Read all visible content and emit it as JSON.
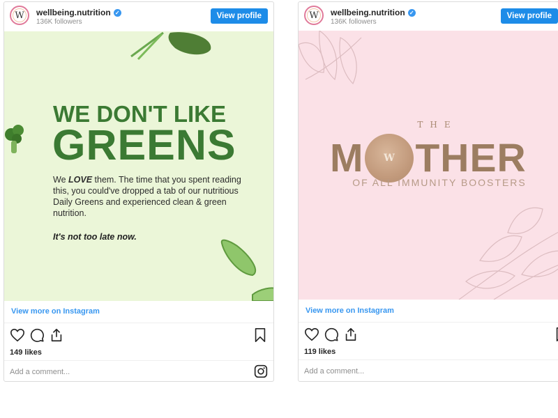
{
  "posts": [
    {
      "account": {
        "avatar_letter": "W",
        "username": "wellbeing.nutrition",
        "verified_mark": "✓",
        "followers": "136K followers"
      },
      "view_profile_label": "View profile",
      "image": {
        "headline_line1": "WE DON'T LIKE",
        "headline_line2": "GREENS",
        "body_prefix": "We ",
        "body_emphasis": "LOVE",
        "body_rest": " them. The time that you spent reading this, you could've dropped a tab of our nutritious Daily Greens and experienced clean & green nutrition.",
        "cta": "It's not too late now.",
        "background_color": "#ebf6d8",
        "text_color": "#3b7a33"
      },
      "view_more_label": "View more on Instagram",
      "likes": "149 likes",
      "comment_placeholder": "Add a comment...",
      "icons": [
        "heart-icon",
        "comment-icon",
        "share-icon",
        "bookmark-icon",
        "instagram-icon"
      ]
    },
    {
      "account": {
        "avatar_letter": "W",
        "username": "wellbeing.nutrition",
        "verified_mark": "✓",
        "followers": "136K followers"
      },
      "view_profile_label": "View profile",
      "image": {
        "kicker": "THE",
        "word_start": "M",
        "tablet_letter": "W",
        "word_end": "THER",
        "subtitle": "OF ALL IMMUNITY BOOSTERS",
        "background_color": "#fbe1e7",
        "text_color": "#9c7d61"
      },
      "view_more_label": "View more on Instagram",
      "likes": "119 likes",
      "comment_placeholder": "Add a comment...",
      "icons": [
        "heart-icon",
        "comment-icon",
        "share-icon",
        "bookmark-icon",
        "instagram-icon"
      ]
    }
  ],
  "colors": {
    "link_blue": "#3897f0",
    "button_blue": "#1d8ce8",
    "border": "#dbdbdb",
    "muted_text": "#8e8e8e"
  }
}
